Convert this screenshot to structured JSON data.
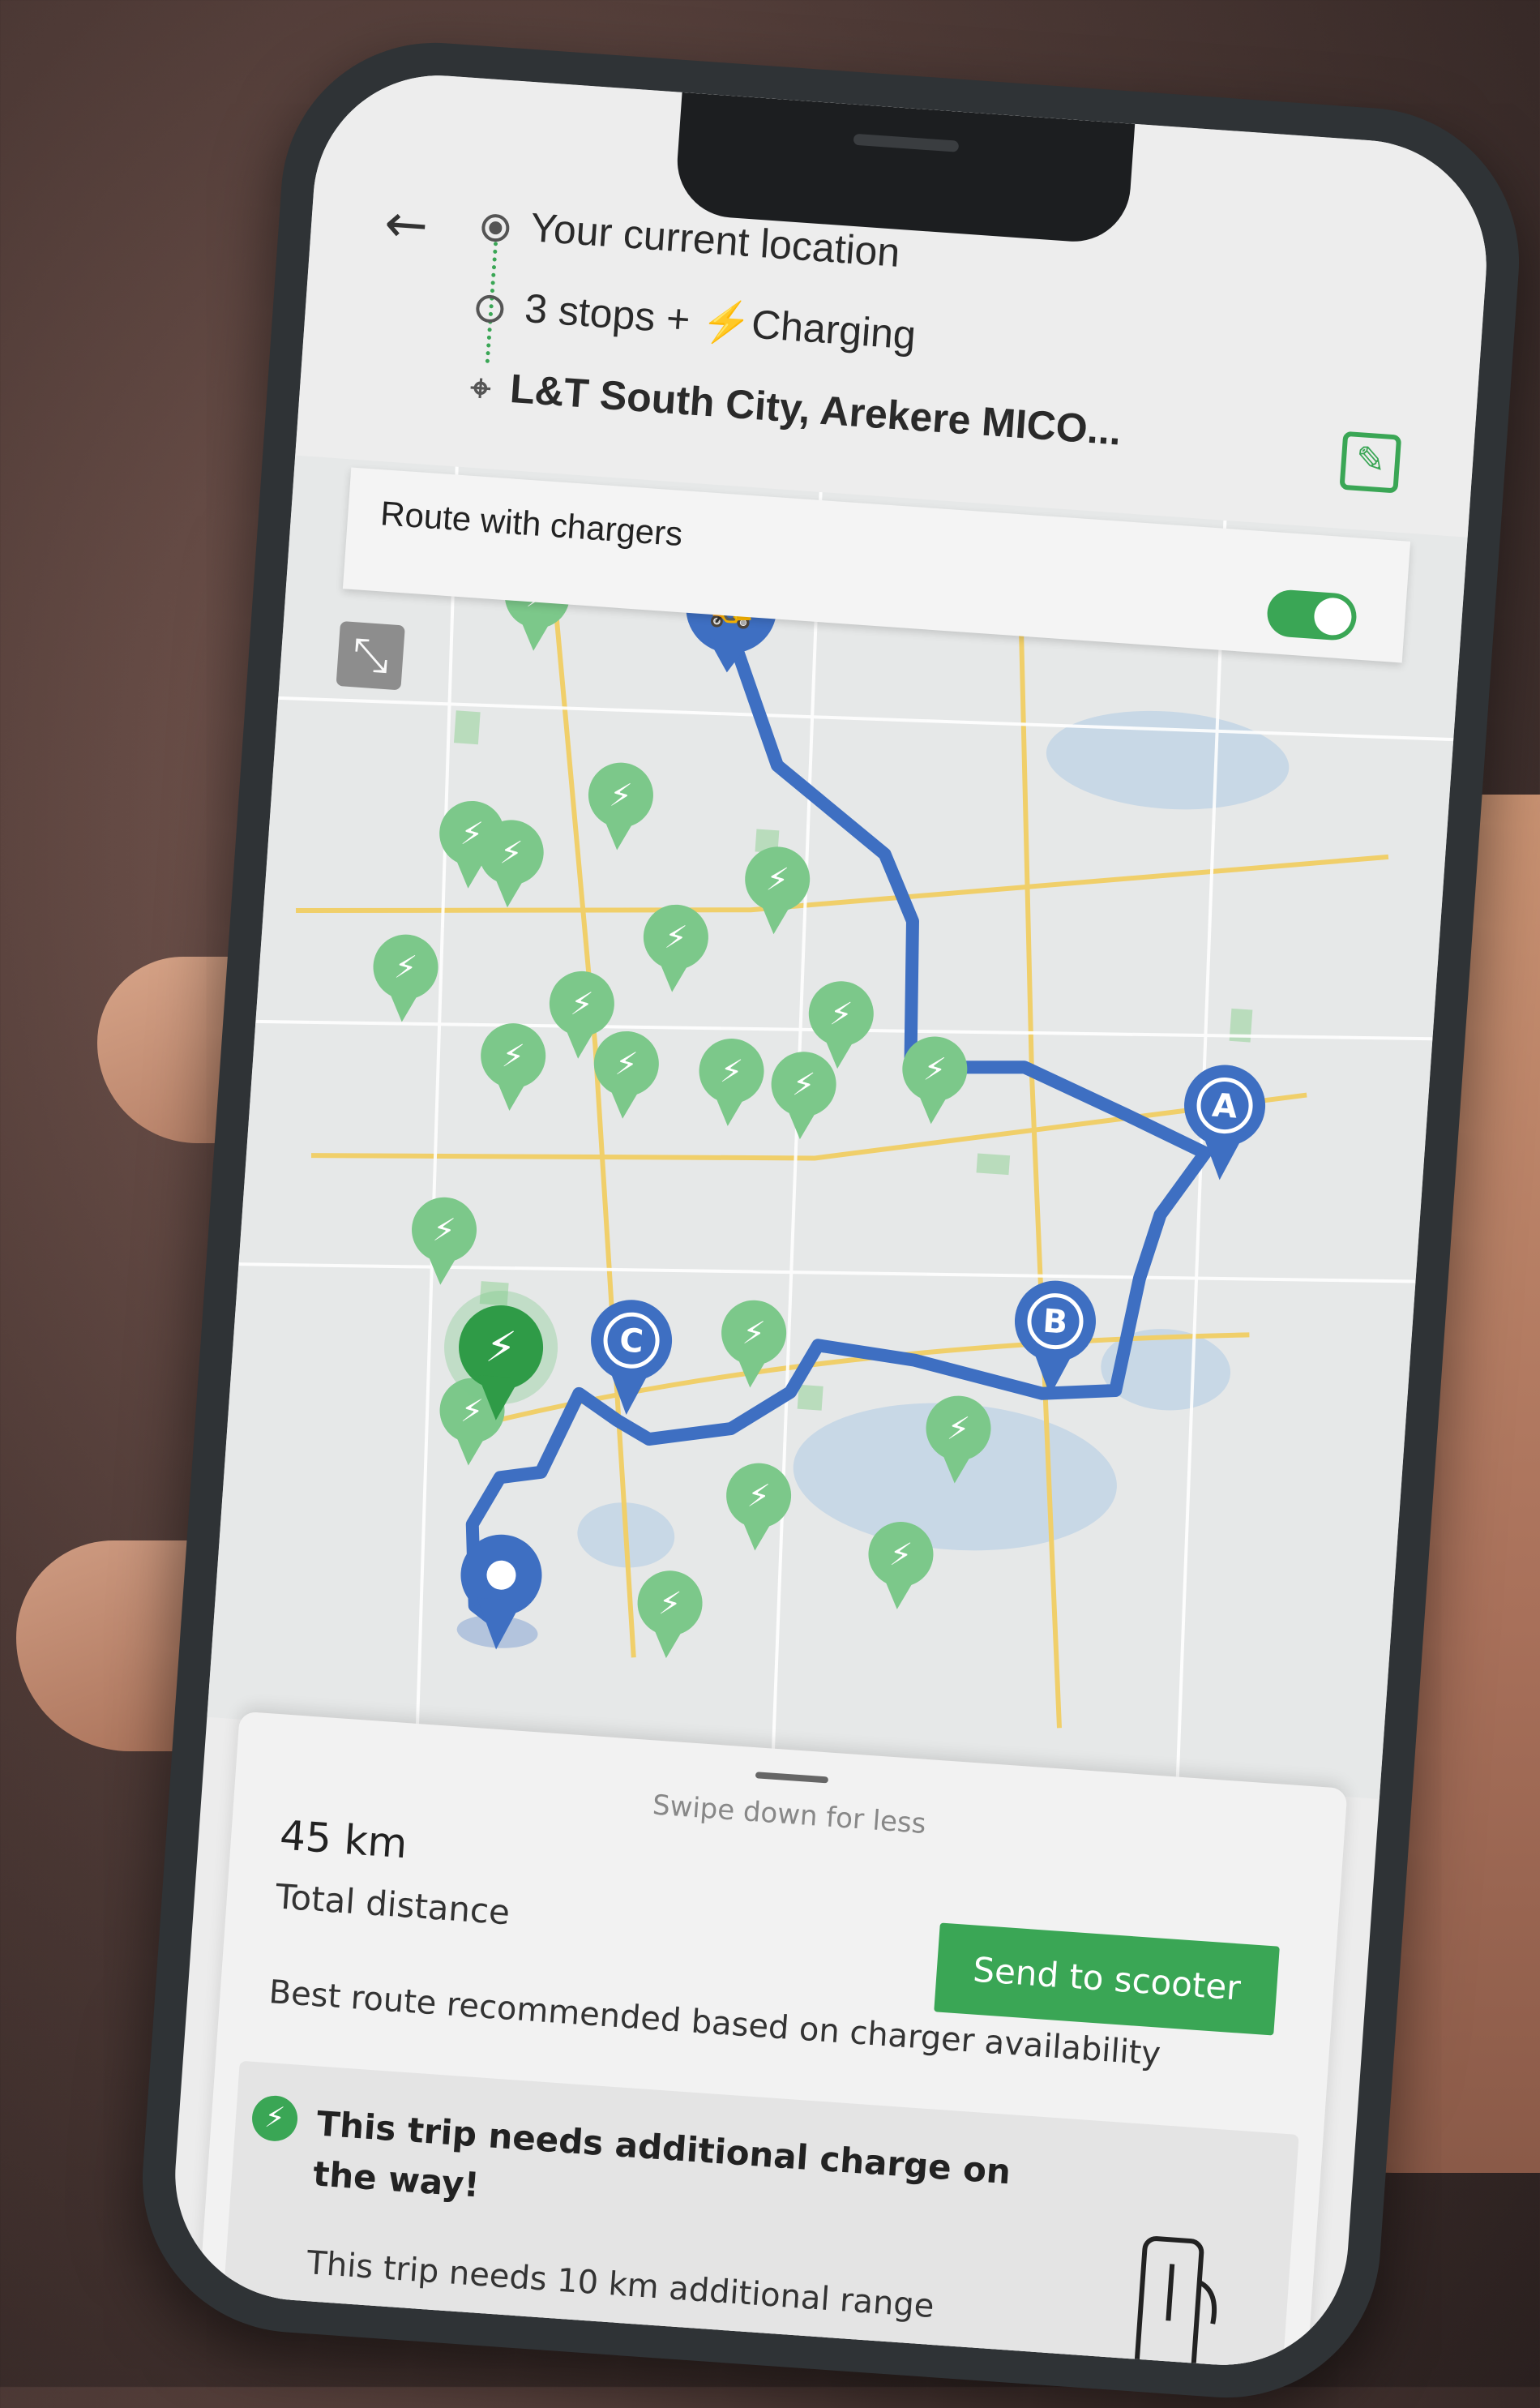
{
  "header": {
    "origin": "Your current location",
    "stops": "3 stops + ",
    "charging_bolt": "⚡",
    "charging": "Charging",
    "destination": "L&T South City, Arekere MICO..."
  },
  "route_bar": {
    "label": "Route with chargers",
    "toggle_on": true
  },
  "map": {
    "route_color": "#3e6fc2",
    "charger_color": "#5cb86a",
    "waypoints": [
      "A",
      "B",
      "C"
    ]
  },
  "sheet": {
    "swipe_hint": "Swipe down for less",
    "distance": "45 km",
    "distance_label": "Total distance",
    "send_button": "Send to scooter",
    "recommendation": "Best route recommended based on charger availability",
    "warning_title": "This trip needs additional charge on the way!",
    "warning_detail": "This trip needs 10 km additional range"
  },
  "colors": {
    "accent": "#3aa655"
  }
}
